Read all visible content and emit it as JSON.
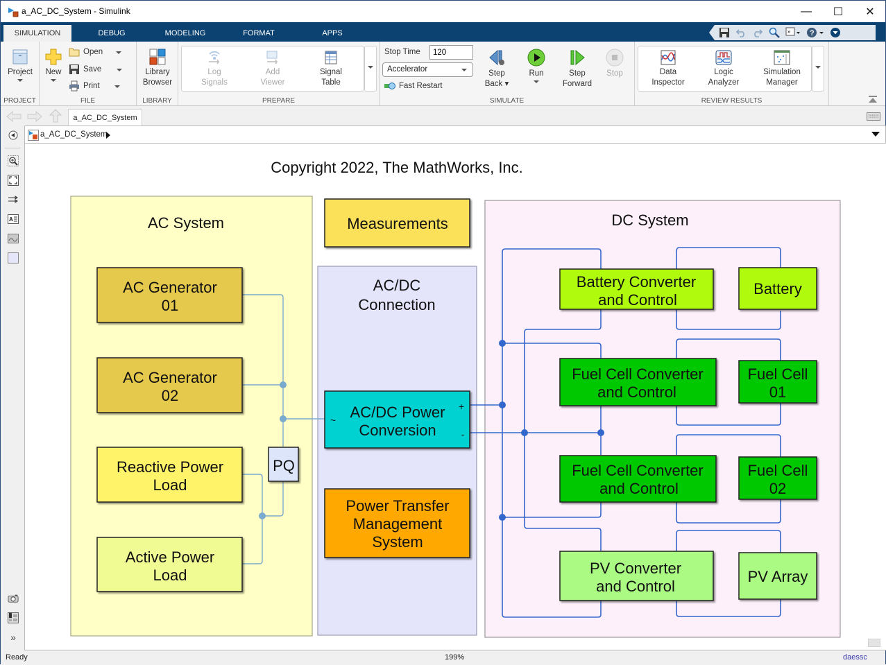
{
  "window": {
    "title": "a_AC_DC_System - Simulink",
    "controls": {
      "minimize": "—",
      "maximize": "☐",
      "close": "✕"
    }
  },
  "tabs": [
    {
      "label": "SIMULATION",
      "active": true
    },
    {
      "label": "DEBUG",
      "active": false
    },
    {
      "label": "MODELING",
      "active": false
    },
    {
      "label": "FORMAT",
      "active": false
    },
    {
      "label": "APPS",
      "active": false
    }
  ],
  "quick_access": [
    "save-icon",
    "undo-icon",
    "redo-icon",
    "search-icon",
    "shortcuts-icon",
    "help-icon",
    "collapse-icon"
  ],
  "ribbon": {
    "project": {
      "button": "Project",
      "group": "PROJECT"
    },
    "file": {
      "new": "New",
      "open": "Open",
      "save": "Save",
      "print": "Print",
      "group": "FILE"
    },
    "library": {
      "button_line1": "Library",
      "button_line2": "Browser",
      "group": "LIBRARY"
    },
    "prepare": {
      "log_signals_1": "Log",
      "log_signals_2": "Signals",
      "add_viewer_1": "Add",
      "add_viewer_2": "Viewer",
      "signal_table_1": "Signal",
      "signal_table_2": "Table",
      "group": "PREPARE"
    },
    "simulate": {
      "stop_time_label": "Stop Time",
      "stop_time_value": "120",
      "mode": "Accelerator",
      "fast_restart": "Fast Restart",
      "step_back_1": "Step",
      "step_back_2": "Back",
      "run": "Run",
      "step_forward_1": "Step",
      "step_forward_2": "Forward",
      "stop": "Stop",
      "group": "SIMULATE"
    },
    "review": {
      "data_inspector_1": "Data",
      "data_inspector_2": "Inspector",
      "logic_analyzer_1": "Logic",
      "logic_analyzer_2": "Analyzer",
      "sim_manager_1": "Simulation",
      "sim_manager_2": "Manager",
      "group": "REVIEW RESULTS"
    }
  },
  "document_tab": "a_AC_DC_System",
  "breadcrumb": "a_AC_DC_System",
  "diagram": {
    "copyright": "Copyright 2022, The MathWorks, Inc.",
    "areas": {
      "ac": "AC System",
      "acdc_1": "AC/DC",
      "acdc_2": "Connection",
      "dc": "DC System"
    },
    "blocks": {
      "measurements": "Measurements",
      "acgen1_1": "AC Generator",
      "acgen1_2": "01",
      "acgen2_1": "AC Generator",
      "acgen2_2": "02",
      "reactive_1": "Reactive Power",
      "reactive_2": "Load",
      "active_1": "Active Power",
      "active_2": "Load",
      "pq": "PQ",
      "conv_1": "AC/DC Power",
      "conv_2": "Conversion",
      "conv_port_ac": "~",
      "conv_port_plus": "+",
      "conv_port_minus": "-",
      "ptms_1": "Power Transfer",
      "ptms_2": "Management",
      "ptms_3": "System",
      "batconv_1": "Battery Converter",
      "batconv_2": "and Control",
      "battery": "Battery",
      "fcconv1_1": "Fuel Cell Converter",
      "fcconv1_2": "and Control",
      "fc1_1": "Fuel Cell",
      "fc1_2": "01",
      "fcconv2_1": "Fuel Cell Converter",
      "fcconv2_2": "and Control",
      "fc2_1": "Fuel Cell",
      "fc2_2": "02",
      "pvconv_1": "PV Converter",
      "pvconv_2": "and Control",
      "pvarray": "PV Array"
    },
    "colors": {
      "ac_area": "#ffffc6",
      "acdc_area": "#e4e4fa",
      "dc_area": "#fdf0fa",
      "ac_generator": "#e5c94e",
      "reactive_load": "#fff36a",
      "active_load": "#f1fb93",
      "pq": "#dde5fb",
      "measurements": "#fbe15a",
      "conversion": "#00d2d2",
      "ptms": "#fea800",
      "battery": "#b0fb08",
      "fuel_cell": "#00c800",
      "pv": "#aafa84",
      "ac_wire": "#7aaacd",
      "dc_wire": "#3467cd"
    }
  },
  "status": {
    "left": "Ready",
    "zoom": "199%",
    "solver": "daessc"
  }
}
